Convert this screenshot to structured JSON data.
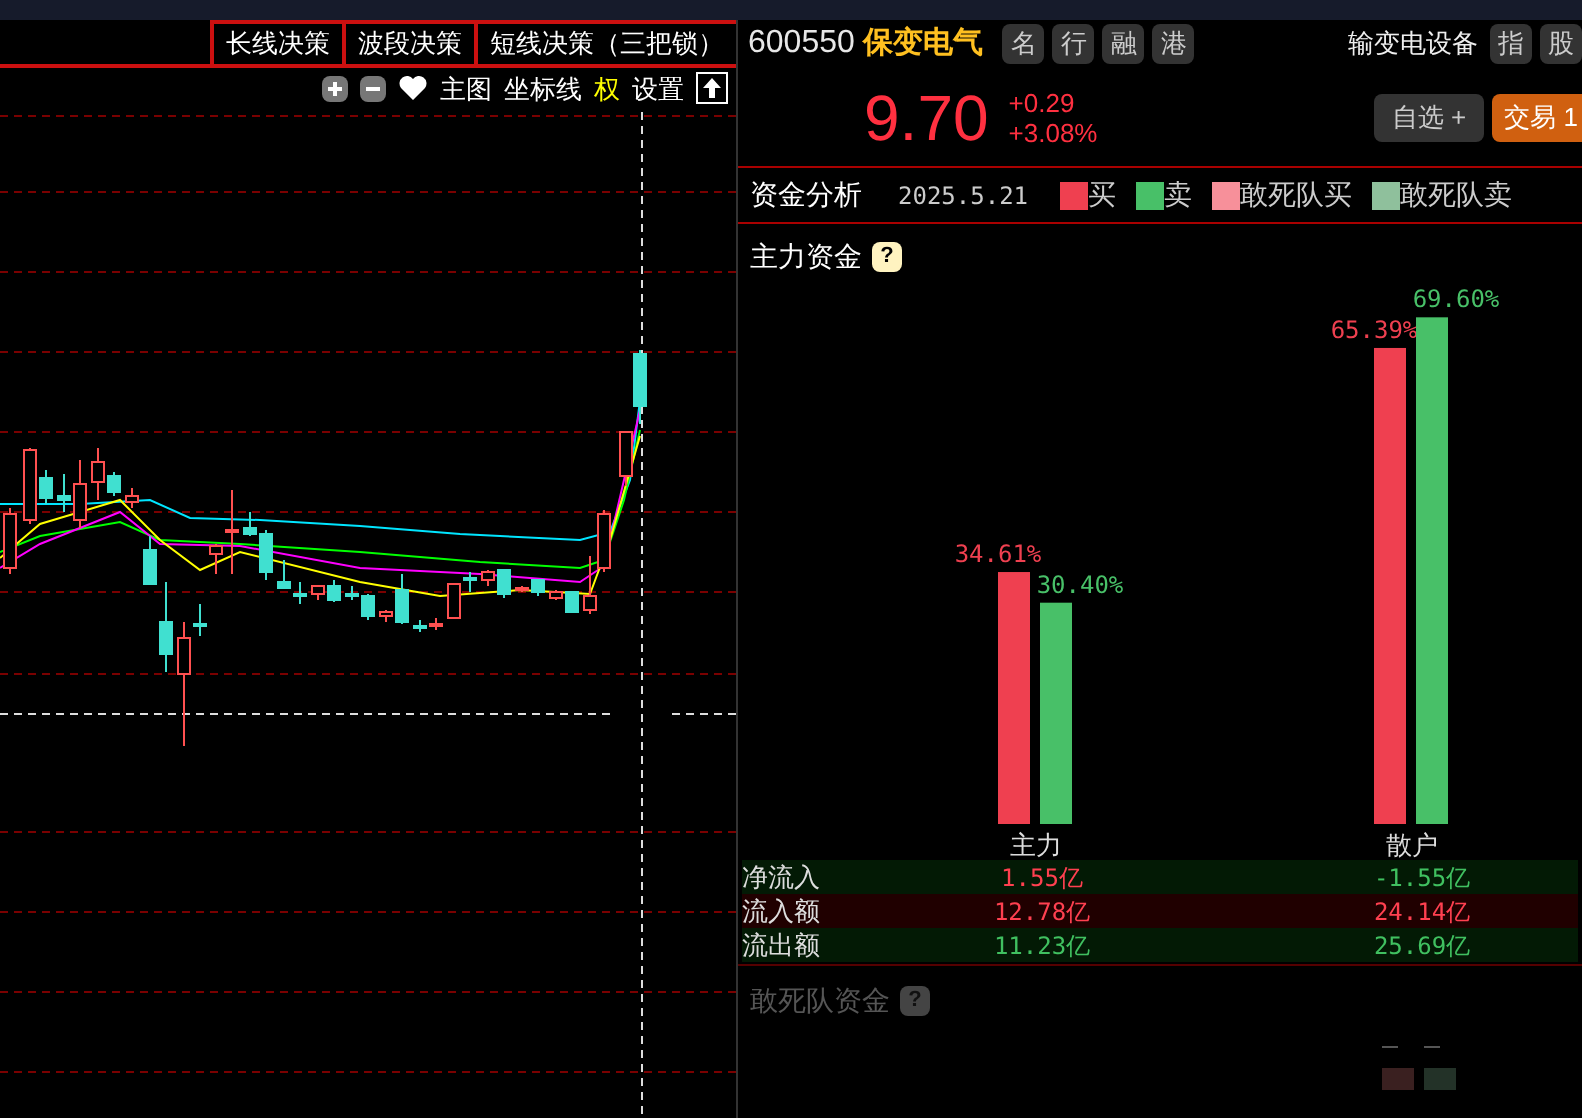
{
  "strategy_tabs": [
    {
      "label": "长线决策",
      "selected": false
    },
    {
      "label": "波段决策",
      "selected": false
    },
    {
      "label": "短线决策（三把锁）",
      "selected": false
    }
  ],
  "chart_toolbar": [
    {
      "kind": "plus"
    },
    {
      "kind": "minus"
    },
    {
      "kind": "heart"
    },
    {
      "kind": "text",
      "label": "主图",
      "highlight": false
    },
    {
      "kind": "text",
      "label": "坐标线",
      "highlight": false
    },
    {
      "kind": "text",
      "label": "权",
      "highlight": true
    },
    {
      "kind": "text",
      "label": "设置",
      "highlight": false
    },
    {
      "kind": "up"
    }
  ],
  "stock": {
    "code": "600550",
    "name": "保变电气",
    "tags": [
      "名",
      "行",
      "融",
      "港"
    ],
    "industry": "输变电设备",
    "side_tags": [
      "指",
      "股"
    ],
    "price": "9.70",
    "change": "+0.29",
    "change_pct": "+3.08%",
    "watch_button": "自选 +",
    "trade_button": "交易 1"
  },
  "analysis": {
    "title": "资金分析",
    "date": "2025.5.21",
    "legend": [
      {
        "label": "买",
        "color": "#ef4050"
      },
      {
        "label": "卖",
        "color": "#48c068"
      },
      {
        "label": "敢死队买",
        "color": "#f7909a"
      },
      {
        "label": "敢死队卖",
        "color": "#8fc09c"
      }
    ]
  },
  "main_funds": {
    "title": "主力资金",
    "help": "?",
    "chart_data": {
      "type": "bar",
      "categories": [
        "主力",
        "散户"
      ],
      "series": [
        {
          "color": "#ef4050",
          "values": [
            34.61,
            65.39
          ],
          "value_labels": [
            "34.61%",
            "65.39%"
          ]
        },
        {
          "color": "#48c068",
          "values": [
            30.4,
            69.6
          ],
          "value_labels": [
            "30.40%",
            "69.60%"
          ]
        }
      ]
    }
  },
  "flow_table": [
    {
      "label": "净流入",
      "kind": "net",
      "cells": [
        {
          "text": "1.55亿",
          "color": "#ff4050"
        },
        {
          "text": "-1.55亿",
          "color": "#40c060"
        }
      ]
    },
    {
      "label": "流入额",
      "kind": "in",
      "cells": [
        {
          "text": "12.78亿",
          "color": "#ff4050"
        },
        {
          "text": "24.14亿",
          "color": "#ff4050"
        }
      ]
    },
    {
      "label": "流出额",
      "kind": "out",
      "cells": [
        {
          "text": "11.23亿",
          "color": "#40c060"
        },
        {
          "text": "25.69亿",
          "color": "#40c060"
        }
      ]
    }
  ],
  "dare_funds": {
    "title": "敢死队资金",
    "help": "?",
    "disabled": true
  }
}
